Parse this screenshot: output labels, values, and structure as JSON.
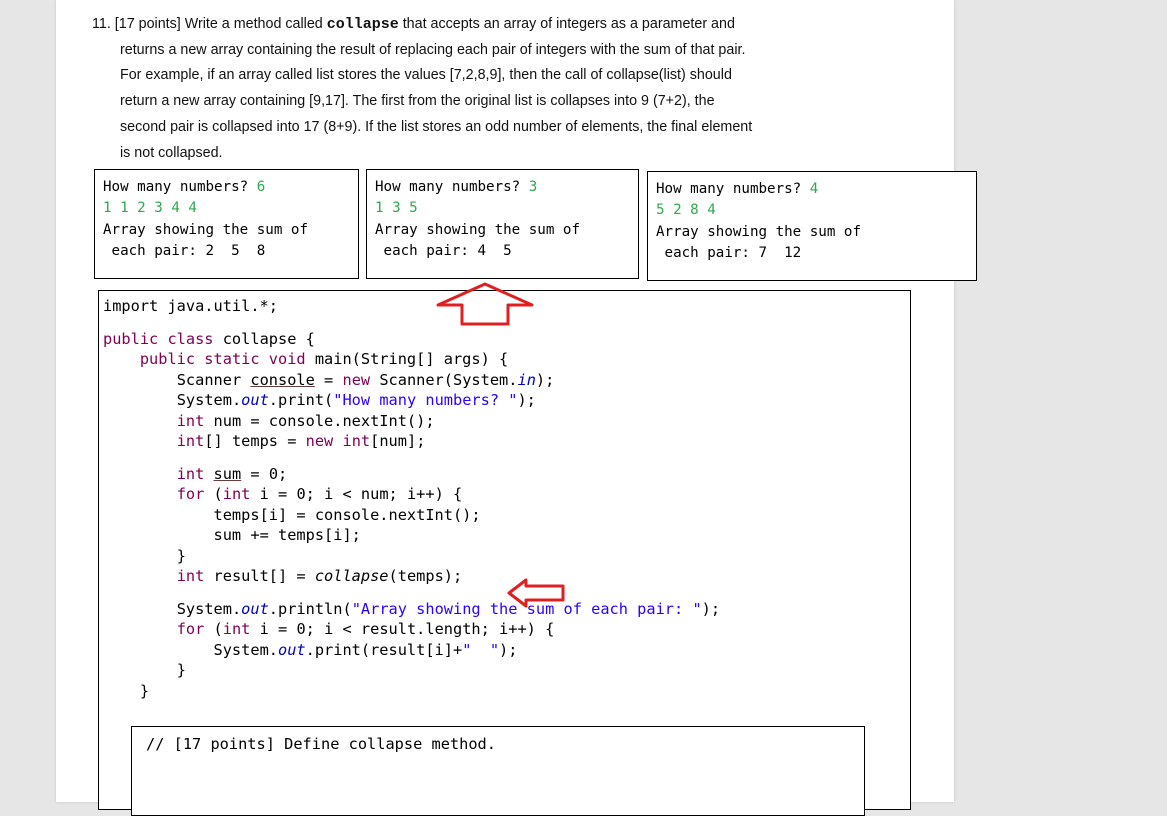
{
  "question": {
    "intro": "11. [17 points] Write a method called",
    "method": "collapse",
    "line1_tail": " that accepts an array of integers as a parameter and",
    "line2": "returns a new array containing the result of replacing each pair of integers with the sum of that pair.",
    "line3": "For example, if an array called list stores the values [7,2,8,9], then the call of collapse(list) should",
    "line4": "return a new array containing [9,17]. The first from the original list is collapses into 9 (7+2), the",
    "line5": "second pair is collapsed into 17 (8+9). If the list stores an odd number of elements, the final element",
    "line6": "is not collapsed."
  },
  "examples": [
    {
      "prompt": "How many numbers? ",
      "count": "6",
      "input": "1 1 2 3 4 4",
      "out1": "Array showing the sum of",
      "out2": " each pair: 2  5  8"
    },
    {
      "prompt": "How many numbers? ",
      "count": "3",
      "input": "1 3 5",
      "out1": "Array showing the sum of",
      "out2": " each pair: 4  5"
    },
    {
      "prompt": "How many numbers? ",
      "count": "4",
      "input": "5 2 8 4",
      "out1": "Array showing the sum of",
      "out2": " each pair: 7  12"
    }
  ],
  "code": {
    "import": "import java.util.*;",
    "class_kw": "public class",
    "class_name": " collapse {",
    "main_kw": "public static void",
    "main_rest": " main(String[] args) {",
    "scanner_pre": "Scanner ",
    "scanner_var": "console",
    "scanner_mid": " = ",
    "scanner_new": "new",
    "scanner_post": " Scanner(System.",
    "scanner_in": "in",
    "scanner_end": ");",
    "print_pre": "System.",
    "print_out": "out",
    "print_mid": ".print(",
    "print_str": "\"How many numbers? \"",
    "print_end": ");",
    "num_kw": "int",
    "num_rest": " num = console.nextInt();",
    "temps_kw": "int",
    "temps_rest": "[] temps = ",
    "temps_new": "new",
    "temps_int": "int",
    "temps_end": "[num];",
    "sum_kw": "int",
    "sum_var": "sum",
    "sum_end": " = 0;",
    "for1_kw": "for",
    "for1_int": "int",
    "for1_rest": " i = 0; i < num; i++) {",
    "read_line": "temps[i] = console.nextInt();",
    "acc_line": "sum += temps[i];",
    "close1": "}",
    "res_kw": "int",
    "res_mid": " result[] = ",
    "res_call": "collapse",
    "res_end": "(temps);",
    "pl_pre": "System.",
    "pl_out": "out",
    "pl_mid": ".println(",
    "pl_str": "\"Array showing the sum of each pair: \"",
    "pl_end": ");",
    "for2_kw": "for",
    "for2_int": "int",
    "for2_rest": " i = 0; i < result.length; i++) {",
    "p2_pre": "System.",
    "p2_out": "out",
    "p2_mid": ".print(result[i]+",
    "p2_str": "\"  \"",
    "p2_end": ");",
    "close2": "}",
    "close3": "}",
    "define_comment": "// [17 points] Define collapse method."
  },
  "colors": {
    "keyword": "#7f0055",
    "string": "#2a00ff",
    "field": "#0000c0",
    "green_input": "#2fa84f",
    "arrow": "#e02020"
  }
}
